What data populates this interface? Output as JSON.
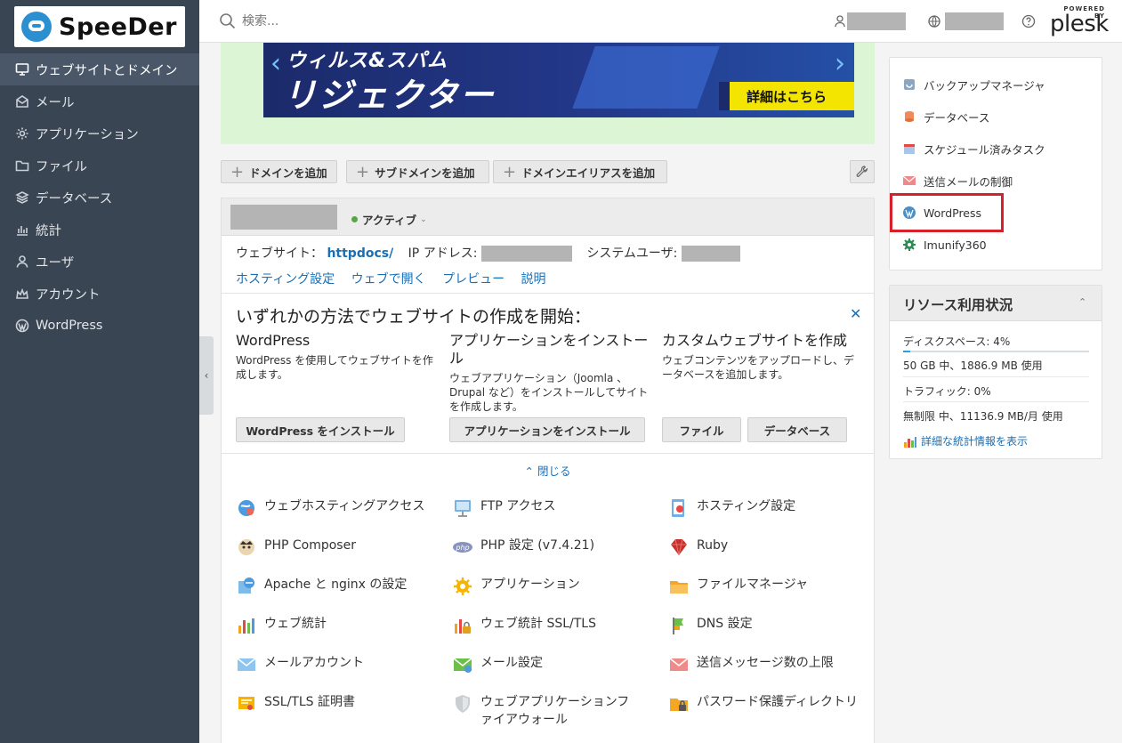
{
  "brand": {
    "logo_text": "SpeeDer"
  },
  "sidebar": {
    "items": [
      {
        "label": "ウェブサイトとドメイン",
        "icon": "monitor-icon",
        "active": true
      },
      {
        "label": "メール",
        "icon": "mail-icon"
      },
      {
        "label": "アプリケーション",
        "icon": "gear-icon"
      },
      {
        "label": "ファイル",
        "icon": "folder-icon"
      },
      {
        "label": "データベース",
        "icon": "layers-icon"
      },
      {
        "label": "統計",
        "icon": "bar-chart-icon"
      },
      {
        "label": "ユーザ",
        "icon": "user-icon"
      },
      {
        "label": "アカウント",
        "icon": "account-icon"
      },
      {
        "label": "WordPress",
        "icon": "wordpress-icon"
      }
    ]
  },
  "header": {
    "search_placeholder": "検索...",
    "powered_by": "POWERED BY",
    "vendor": "plesk"
  },
  "banner": {
    "title_line1": "ウィルス&スパム",
    "title_line2": "リジェクター",
    "cta": "詳細はこちら"
  },
  "actions": {
    "add_domain": "ドメインを追加",
    "add_subdomain": "サブドメインを追加",
    "add_alias": "ドメインエイリアスを追加"
  },
  "domain": {
    "status": "アクティブ",
    "website_label": "ウェブサイト：",
    "website_value": "httpdocs/",
    "ip_label": "IP アドレス:",
    "sysuser_label": "システムユーザ:",
    "links": [
      "ホスティング設定",
      "ウェブで開く",
      "プレビュー",
      "説明"
    ],
    "start_title": "いずれかの方法でウェブサイトの作成を開始：",
    "columns": [
      {
        "title": "WordPress",
        "desc": "WordPress を使用してウェブサイトを作成します。",
        "button": "WordPress をインストール"
      },
      {
        "title": "アプリケーションをインストール",
        "desc": "ウェブアプリケーション（Joomla 、Drupal など）をインストールしてサイトを作成します。",
        "button": "アプリケーションをインストール"
      },
      {
        "title": "カスタムウェブサイトを作成",
        "desc": "ウェブコンテンツをアップロードし、データベースを追加します。",
        "buttons": [
          "ファイル",
          "データベース"
        ]
      }
    ],
    "close_label": "閉じる",
    "tools": [
      "ウェブホスティングアクセス",
      "FTP アクセス",
      "ホスティング設定",
      "PHP Composer",
      "PHP 設定 (v7.4.21)",
      "Ruby",
      "Apache と nginx の設定",
      "アプリケーション",
      "ファイルマネージャ",
      "ウェブ統計",
      "ウェブ統計 SSL/TLS",
      "DNS 設定",
      "メールアカウント",
      "メール設定",
      "送信メッセージ数の上限",
      "SSL/TLS 証明書",
      "ウェブアプリケーションファイアウォール",
      "パスワード保護ディレクトリ"
    ]
  },
  "right_panel": {
    "items": [
      "バックアップマネージャ",
      "データベース",
      "スケジュール済みタスク",
      "送信メールの制御",
      "WordPress",
      "Imunify360"
    ],
    "resources": {
      "title": "リソース利用状況",
      "disk_label": "ディスクスペース: 4%",
      "disk_percent": 4,
      "disk_detail": "50 GB 中、1886.9 MB 使用",
      "traffic_label": "トラフィック: 0%",
      "traffic_detail": "無制限 中、11136.9 MB/月 使用",
      "stats_link": "詳細な統計情報を表示"
    }
  },
  "colors": {
    "sidebar_bg": "#3a4553",
    "accent": "#1a6fb5",
    "highlight": "#d6202a"
  }
}
